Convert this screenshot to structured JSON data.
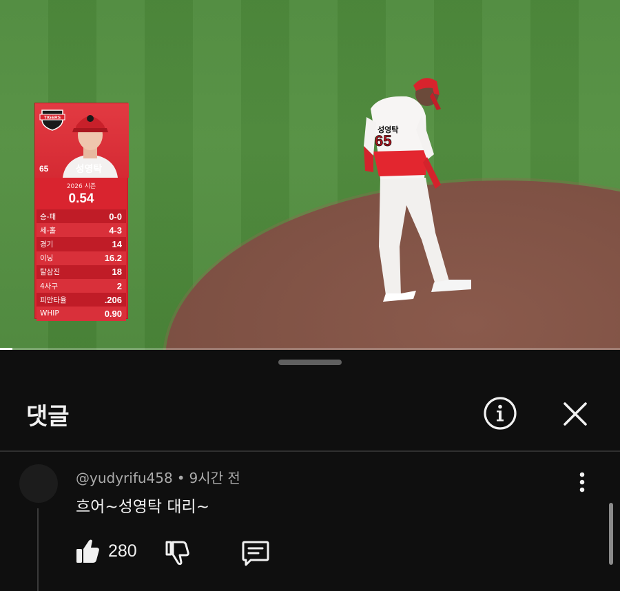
{
  "video": {
    "progress_fraction": 0.02,
    "stat_card": {
      "team_logo": "TIGERS",
      "number": "65",
      "name": "성영탁",
      "season": "2026 시즌",
      "era": "0.54",
      "stats": [
        {
          "label": "승-패",
          "value": "0-0"
        },
        {
          "label": "세-홀",
          "value": "4-3"
        },
        {
          "label": "경기",
          "value": "14"
        },
        {
          "label": "이닝",
          "value": "16.2"
        },
        {
          "label": "탈삼진",
          "value": "18"
        },
        {
          "label": "4사구",
          "value": "2"
        },
        {
          "label": "피안타율",
          "value": ".206"
        },
        {
          "label": "WHIP",
          "value": "0.90"
        }
      ]
    },
    "jersey": {
      "name": "성영탁",
      "number": "65"
    }
  },
  "comments": {
    "title": "댓글",
    "header_icons": {
      "info": "info-icon",
      "close": "close-icon"
    },
    "items": [
      {
        "author": "@yudyrifu458",
        "separator": "•",
        "time": "9시간 전",
        "text": "흐어~성영탁 대리~",
        "likes": "280",
        "icons": {
          "like": "thumbs-up-icon",
          "dislike": "thumbs-down-icon",
          "reply": "reply-icon",
          "more": "more-vertical-icon"
        }
      }
    ]
  },
  "colors": {
    "sheet_bg": "#0f0f0f",
    "card_red": "#d9242f",
    "text_primary": "#f1f1f1",
    "text_secondary": "#aaaaaa"
  }
}
